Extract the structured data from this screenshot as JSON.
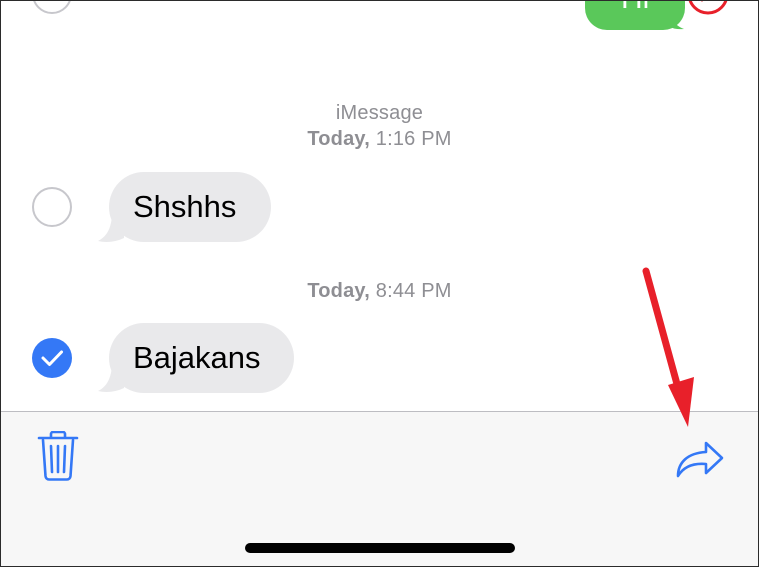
{
  "previous_message": {
    "text": "Hi",
    "selected": false
  },
  "timestamps": [
    {
      "service": "iMessage",
      "day": "Today,",
      "time": "1:16 PM"
    },
    {
      "service": "",
      "day": "Today,",
      "time": "8:44 PM"
    }
  ],
  "messages": [
    {
      "text": "Shshhs",
      "selected": false
    },
    {
      "text": "Bajakans",
      "selected": true
    }
  ],
  "toolbar": {
    "delete_icon": "trash-icon",
    "forward_icon": "forward-arrow-icon"
  },
  "colors": {
    "accent": "#3478f6",
    "received_bubble": "#e9e9eb",
    "sent_bubble": "#5ac85a",
    "annotation": "#e8202a",
    "timestamp": "#8e8e93"
  }
}
